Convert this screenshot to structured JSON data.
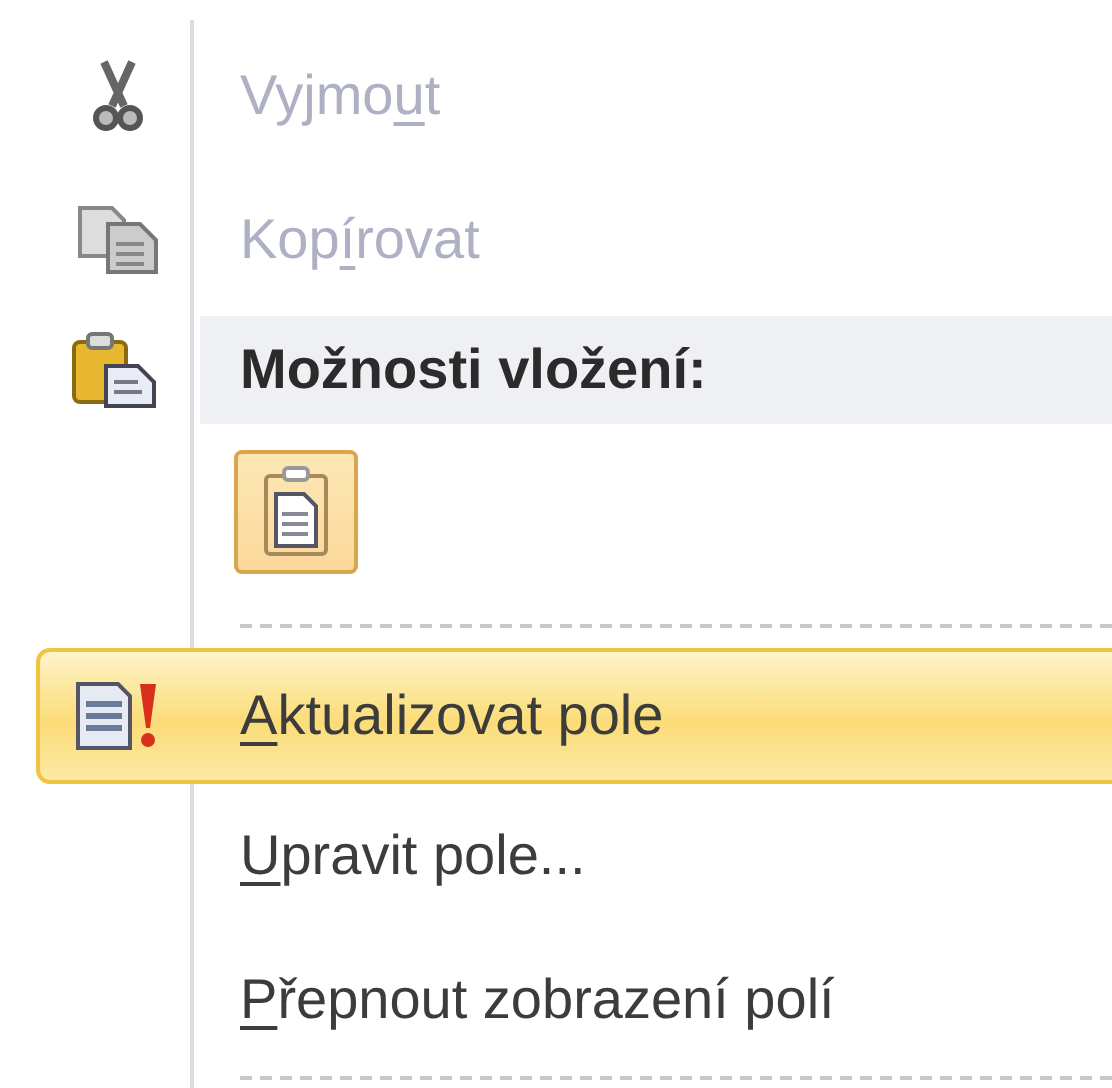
{
  "menu": {
    "items": [
      {
        "kind": "command",
        "before": "Vyjmo",
        "key": "u",
        "after": "t",
        "disabled": true,
        "highlighted": false
      },
      {
        "kind": "command",
        "before": "Kop",
        "key": "í",
        "after": "rovat",
        "disabled": true,
        "highlighted": false
      },
      {
        "kind": "header",
        "label": "Možnosti vložení:"
      },
      {
        "kind": "paste_options"
      },
      {
        "kind": "separator"
      },
      {
        "kind": "command",
        "key": "A",
        "after": "ktualizovat pole",
        "disabled": false,
        "highlighted": true
      },
      {
        "kind": "command",
        "key": "U",
        "after": "pravit pole...",
        "disabled": false,
        "highlighted": false
      },
      {
        "kind": "command",
        "key": "P",
        "after": "řepnout zobrazení polí",
        "disabled": false,
        "highlighted": false
      },
      {
        "kind": "separator"
      }
    ]
  }
}
